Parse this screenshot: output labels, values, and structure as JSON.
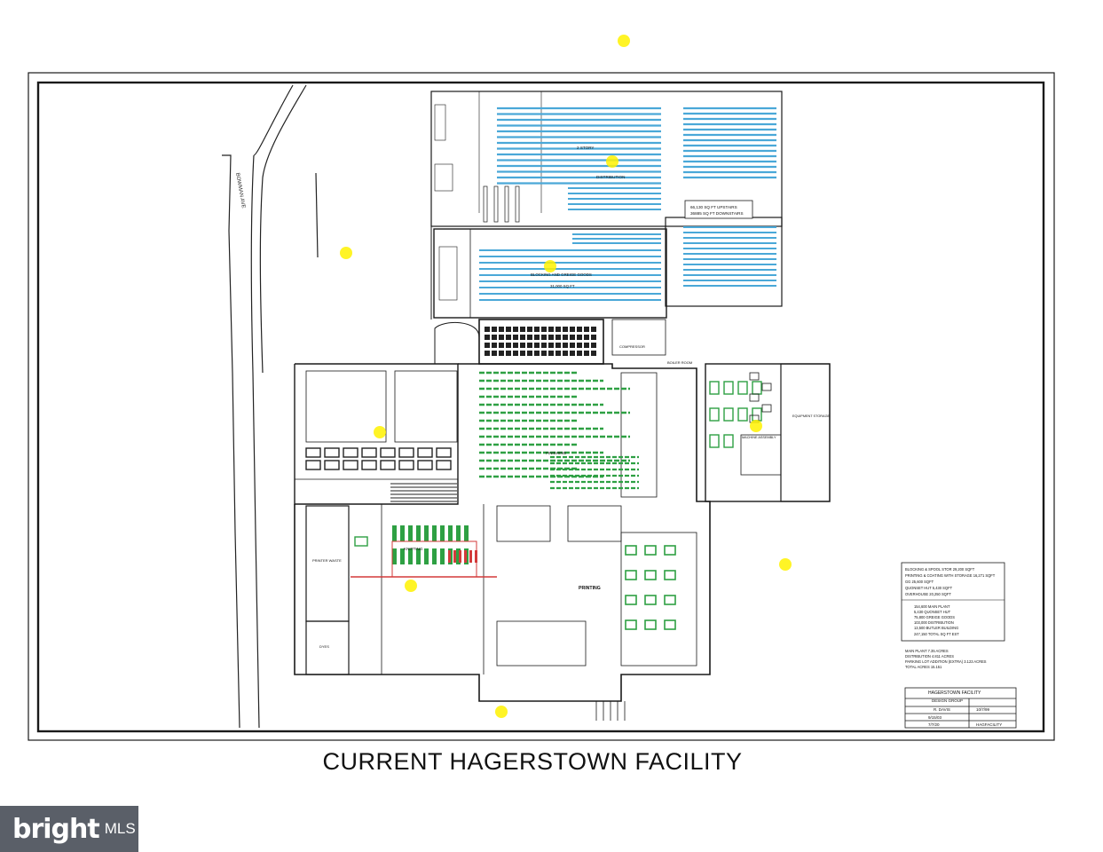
{
  "caption": "CURRENT HAGERSTOWN FACILITY",
  "watermark": {
    "brand": "bright",
    "suffix": "MLS"
  },
  "street_label": "BOWMAN AVE",
  "room_labels": {
    "distribution": "DISTRIBUTION",
    "story": "2 STORY",
    "upstairs_area": "66,130 SQ FT UPSTAIRS",
    "downstairs_area": "36885 SQ FT DOWNSTAIRS",
    "blocking": "BLOCKING AND GREIGE GOODS",
    "blocking_area": "31,000 SQ FT",
    "compressor": "COMPRESSOR",
    "boiler": "BOILER ROOM",
    "machine": "MACHINE ASSEMBLY",
    "equipment": "EQUIPMENT STORAGE",
    "printing": "PRINTING",
    "finishing": "FINISHING",
    "knitting": "KNITTING",
    "printer_waste": "PRINTER WASTE",
    "dyes": "DYES"
  },
  "notes_box": [
    "BLOCKING & SPOOL STOR 29,200 SQFT",
    "PRINTING & COATING WITH STORAGE 16,271 SQFT",
    "GG 25,600 SQFT",
    "QUONSET HUT 5,430 SQFT",
    "OVERHOUSE 20,250 SQFT"
  ],
  "area_summary": [
    "154,600 MAIN PLANT",
    "5,430 QUONSET HUT",
    "75,800 GREIGE GOODS",
    "103,000 DISTRIBUTION",
    "13,500 BUTLER BUILDING",
    "247,150 TOTAL SQ FT EST"
  ],
  "acreage": [
    "MAIN PLANT 7.35 ACRES",
    "DISTRIBUTION 4.811 ACRES",
    "PARKING LOT ADDITION (EXTRA) 3.123 ACRES",
    "TOTAL ACRES 15.151"
  ],
  "title_block": {
    "title": "HAGERSTOWN FACILITY",
    "group": "DESIGN GROUP",
    "drawn_by": "R. DAVIS",
    "date1": "10/7/99",
    "rev1": "9/15/03",
    "rev2": "7/7/20",
    "file": "HAGFACILITY"
  },
  "colors": {
    "line": "#1a1a1a",
    "blue_racks": "#4aa8d8",
    "green_equipment": "#2ea043",
    "red_equipment": "#d33a3a",
    "highlight": "#fff200"
  }
}
